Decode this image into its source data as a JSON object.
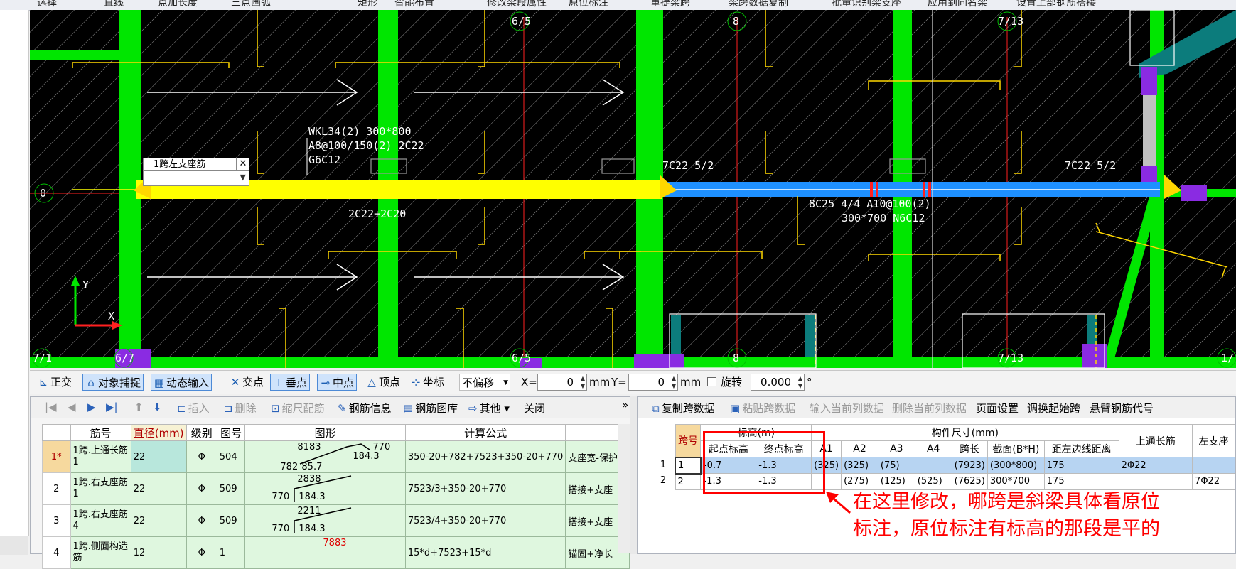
{
  "top_toolbar": [
    "选择",
    "直线",
    "点加长度",
    "三点画弧",
    "矩形",
    "智能布置",
    "修改梁段属性",
    "原位标注",
    "重提梁跨",
    "梁跨数据复制",
    "批量识别梁支座",
    "应用到同名梁",
    "设置上部钢筋搭接"
  ],
  "cad": {
    "axis_labels": [
      "6/5",
      "8",
      "7/13",
      "0",
      "7/1",
      "6/7",
      "6/5",
      "8",
      "7/13",
      "1/"
    ],
    "beam_text_1": "WKL34(2) 300*800",
    "beam_text_2": "A8@100/150(2) 2C22",
    "beam_text_3": "G6C12",
    "span_text_left": "7C22 5/2",
    "span_text_right": "7C22 5/2",
    "bottom_text": "2C22+2C20",
    "beam2_text_1": "8C25 4/4 A10@100(2)",
    "beam2_text_2": "300*700 N6C12",
    "axis_x": "X",
    "axis_y": "Y",
    "colors": {
      "beam_yellow": "#ffff00",
      "beam_blue": "#1e90ff",
      "column_green": "#00e600",
      "support_yellow": "#ffd700",
      "grid_red": "#ff0000"
    }
  },
  "span_edit": {
    "title": "1跨左支座筋",
    "value": ""
  },
  "snap_bar": {
    "items": [
      "正交",
      "对象捕捉",
      "动态输入",
      "交点",
      "垂点",
      "中点",
      "顶点",
      "坐标"
    ],
    "offset_mode": "不偏移",
    "x_label": "X=",
    "x_value": "0",
    "mm1": "mm",
    "y_label": "Y=",
    "y_value": "0",
    "mm2": "mm",
    "rotate_label": "旋转",
    "rotate_value": "0.000",
    "degree": "°"
  },
  "rebar_toolbar": [
    "插入",
    "删除",
    "缩尺配筋",
    "钢筋信息",
    "钢筋图库",
    "其他",
    "关闭"
  ],
  "rebar_table": {
    "headers": [
      "筋号",
      "直径(mm)",
      "级别",
      "图号",
      "图形",
      "计算公式",
      ""
    ],
    "rows": [
      {
        "no": "1*",
        "name": "1跨.上通长筋1",
        "dia": "22",
        "grade": "Φ",
        "fig": "504",
        "shape_top": "8183",
        "shape_r": "770",
        "shape_mid": "184.3",
        "shape_bl": "782",
        "shape_br": "85.7",
        "formula": "350-20+782+7523+350-20+770",
        "desc": "支座宽-保护层"
      },
      {
        "no": "2",
        "name": "1跨.右支座筋1",
        "dia": "22",
        "grade": "Φ",
        "fig": "509",
        "shape_top": "2838",
        "shape_bl": "770",
        "shape_mid": "184.3",
        "formula": "7523/3+350-20+770",
        "desc": "搭接+支座"
      },
      {
        "no": "3",
        "name": "1跨.右支座筋4",
        "dia": "22",
        "grade": "Φ",
        "fig": "509",
        "shape_top": "2211",
        "shape_bl": "770",
        "shape_mid": "184.3",
        "formula": "7523/4+350-20+770",
        "desc": "搭接+支座"
      },
      {
        "no": "4",
        "name": "1跨.侧面构造筋",
        "dia": "12",
        "grade": "Φ",
        "fig": "1",
        "shape_top": "7883",
        "formula": "15*d+7523+15*d",
        "desc": "锚固+净长"
      }
    ]
  },
  "span_toolbar": [
    "复制跨数据",
    "粘贴跨数据",
    "输入当前列数据",
    "删除当前列数据",
    "页面设置",
    "调换起始跨",
    "悬臂钢筋代号"
  ],
  "span_table": {
    "group_elev": "标高(m)",
    "group_size": "构件尺寸(mm)",
    "h_span": "跨号",
    "h_start": "起点标高",
    "h_end": "终点标高",
    "h_a1": "A1",
    "h_a2": "A2",
    "h_a3": "A3",
    "h_a4": "A4",
    "h_len": "跨长",
    "h_sec": "截面(B*H)",
    "h_dist": "距左边线距离",
    "h_top": "上通长筋",
    "h_left": "左支座",
    "rows": [
      {
        "row": "1",
        "span": "1",
        "start": "-0.7",
        "end": "-1.3",
        "a1": "(325)",
        "a2": "(325)",
        "a3": "(75)",
        "a4": "",
        "len": "(7923)",
        "sec": "(300*800)",
        "dist": "175",
        "top": "2Φ22",
        "left": ""
      },
      {
        "row": "2",
        "span": "2",
        "start": "-1.3",
        "end": "-1.3",
        "a1": "",
        "a2": "(275)",
        "a3": "(125)",
        "a4": "(525)",
        "len": "(7625)",
        "sec": "300*700",
        "dist": "175",
        "top": "",
        "left": "7Φ22"
      }
    ]
  },
  "annotation": {
    "line1": "在这里修改，哪跨是斜梁具体看原位",
    "line2": "标注，原位标注有标高的那段是平的"
  }
}
